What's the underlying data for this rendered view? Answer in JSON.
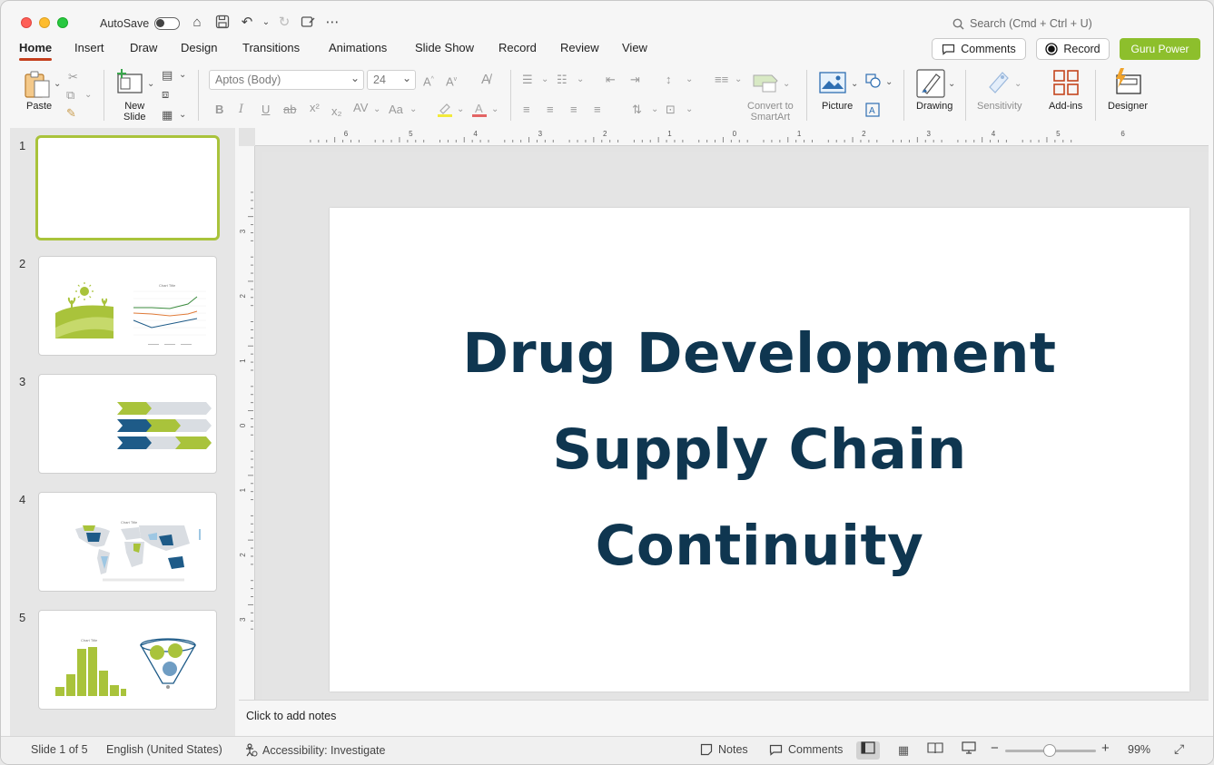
{
  "window": {
    "autosave_label": "AutoSave",
    "search_placeholder": "Search (Cmd + Ctrl + U)"
  },
  "tabs": [
    "Home",
    "Insert",
    "Draw",
    "Design",
    "Transitions",
    "Animations",
    "Slide Show",
    "Record",
    "Review",
    "View"
  ],
  "top_buttons": {
    "comments": "Comments",
    "record": "Record",
    "guru": "Guru Power"
  },
  "ribbon": {
    "paste": "Paste",
    "new_slide_1": "New",
    "new_slide_2": "Slide",
    "font_name": "Aptos (Body)",
    "font_size": "24",
    "smartart_1": "Convert to",
    "smartart_2": "SmartArt",
    "picture": "Picture",
    "drawing": "Drawing",
    "sensitivity": "Sensitivity",
    "addins": "Add-ins",
    "designer": "Designer"
  },
  "ruler": {
    "h_labels": [
      "6",
      "5",
      "4",
      "3",
      "2",
      "1",
      "0",
      "1",
      "2",
      "3",
      "4",
      "5",
      "6"
    ],
    "v_labels": [
      "3",
      "2",
      "1",
      "0",
      "1",
      "2",
      "3"
    ]
  },
  "thumbnails": [
    "1",
    "2",
    "3",
    "4",
    "5"
  ],
  "thumb_text": {
    "chart_title": "Chart Title"
  },
  "slide": {
    "title_lines": [
      "Drug Development",
      "Supply Chain",
      "Continuity"
    ]
  },
  "notes": {
    "placeholder": "Click to add notes"
  },
  "status": {
    "slide_count": "Slide 1 of 5",
    "language": "English (United States)",
    "accessibility": "Accessibility: Investigate",
    "notes": "Notes",
    "comments": "Comments",
    "zoom": "99%"
  },
  "colors": {
    "accent_green": "#8dbf2c",
    "title_navy": "#0f3650",
    "tab_underline": "#c43e1c"
  }
}
